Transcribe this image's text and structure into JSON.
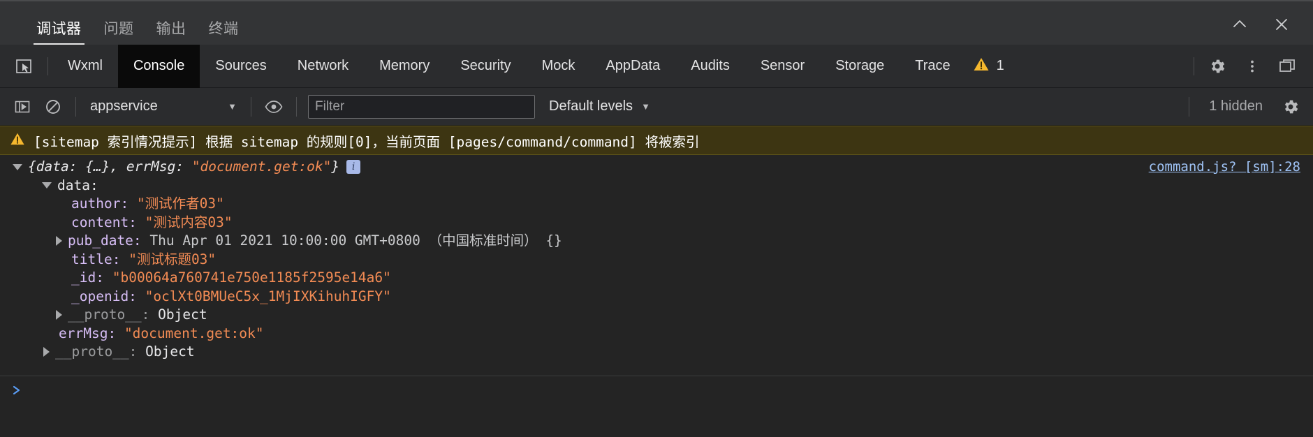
{
  "panel": {
    "tabs": [
      {
        "label": "调试器",
        "active": true
      },
      {
        "label": "问题",
        "active": false
      },
      {
        "label": "输出",
        "active": false
      },
      {
        "label": "终端",
        "active": false
      }
    ],
    "collapse_icon": "chevron-up-icon",
    "close_icon": "close-icon"
  },
  "devtools": {
    "inspect_icon": "inspect-element-icon",
    "tabs": [
      {
        "label": "Wxml",
        "active": false
      },
      {
        "label": "Console",
        "active": true
      },
      {
        "label": "Sources",
        "active": false
      },
      {
        "label": "Network",
        "active": false
      },
      {
        "label": "Memory",
        "active": false
      },
      {
        "label": "Security",
        "active": false
      },
      {
        "label": "Mock",
        "active": false
      },
      {
        "label": "AppData",
        "active": false
      },
      {
        "label": "Audits",
        "active": false
      },
      {
        "label": "Sensor",
        "active": false
      },
      {
        "label": "Storage",
        "active": false
      },
      {
        "label": "Trace",
        "active": false
      }
    ],
    "warning_count": "1",
    "warning_color": "#f5b82e",
    "settings_icon": "gear-icon",
    "more_icon": "kebab-menu-icon",
    "dock_icon": "dock-window-icon"
  },
  "console_toolbar": {
    "sidebar_toggle_icon": "console-sidebar-icon",
    "clear_icon": "clear-console-icon",
    "context_selected": "appservice",
    "context_caret": "▼",
    "eye_icon": "live-expression-icon",
    "filter_placeholder": "Filter",
    "filter_value": "",
    "levels_label": "Default levels",
    "levels_caret": "▼",
    "hidden_label": "1 hidden",
    "settings_icon": "gear-icon"
  },
  "console": {
    "warning": {
      "icon": "warning-triangle-icon",
      "text": "[sitemap 索引情况提示] 根据 sitemap 的规则[0]，当前页面 [pages/command/command] 将被索引",
      "background": "#3d3512"
    },
    "entry": {
      "source_link": "command.js? [sm]:28",
      "header_prefix": "{data: {…}, errMsg: ",
      "header_string": "\"document.get:ok\"",
      "header_suffix": "}",
      "info_badge": "i",
      "data_key": "data:",
      "props": [
        {
          "key": "author:",
          "value": "\"测试作者03\"",
          "type": "string",
          "expandable": false
        },
        {
          "key": "content:",
          "value": "\"测试内容03\"",
          "type": "string",
          "expandable": false
        },
        {
          "key": "pub_date:",
          "value": "Thu Apr 01 2021 10:00:00 GMT+0800 （中国标准时间） {}",
          "type": "plain",
          "expandable": true
        },
        {
          "key": "title:",
          "value": "\"测试标题03\"",
          "type": "string",
          "expandable": false
        },
        {
          "key": "_id:",
          "value": "\"b00064a760741e750e1185f2595e14a6\"",
          "type": "string",
          "expandable": false
        },
        {
          "key": "_openid:",
          "value": "\"oclXt0BMUeC5x_1MjIXKihuhIGFY\"",
          "type": "string",
          "expandable": false
        },
        {
          "key": "__proto__:",
          "value": "Object",
          "type": "proto",
          "expandable": true
        }
      ],
      "errmsg_key": "errMsg:",
      "errmsg_value": "\"document.get:ok\"",
      "root_proto_key": "__proto__:",
      "root_proto_value": "Object"
    },
    "prompt": {
      "caret": "❯",
      "value": "",
      "placeholder": ""
    }
  }
}
